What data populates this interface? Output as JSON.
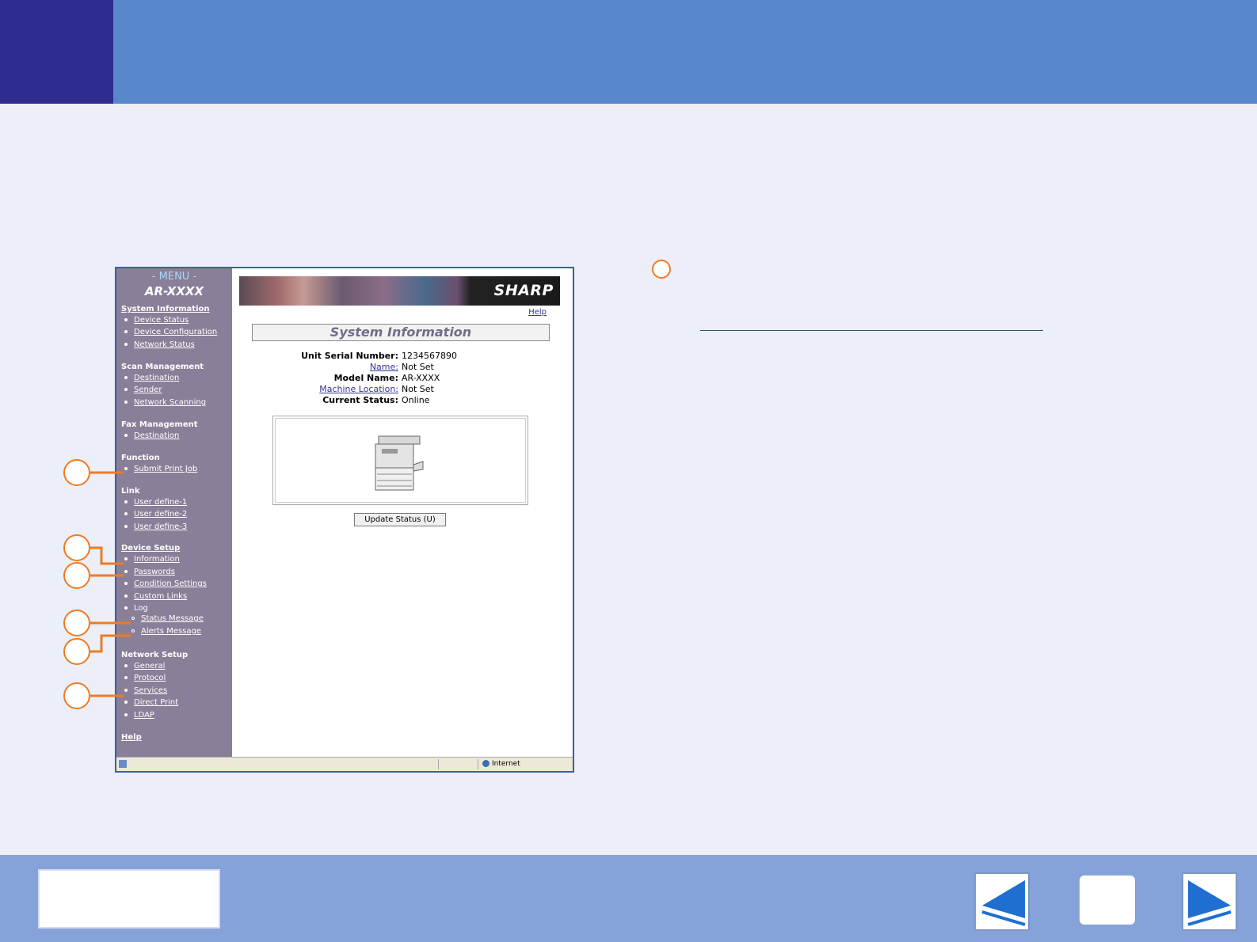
{
  "sidebar": {
    "menu_title": "- MENU -",
    "model": "AR-XXXX",
    "sections": {
      "system_information": {
        "title": "System Information",
        "items": [
          "Device Status",
          "Device Configuration",
          "Network Status"
        ]
      },
      "scan_management": {
        "title": "Scan Management",
        "items": [
          "Destination",
          "Sender",
          "Network Scanning"
        ]
      },
      "fax_management": {
        "title": "Fax Management",
        "items": [
          "Destination"
        ]
      },
      "function": {
        "title": "Function",
        "items": [
          "Submit Print Job"
        ]
      },
      "link": {
        "title": "Link",
        "items": [
          "User define-1",
          "User define-2",
          "User define-3"
        ]
      },
      "device_setup": {
        "title": "Device Setup",
        "items": [
          "Information",
          "Passwords",
          "Condition Settings",
          "Custom Links",
          "Log"
        ],
        "sub_items": [
          "Status Message",
          "Alerts Message"
        ]
      },
      "network_setup": {
        "title": "Network Setup",
        "items": [
          "General",
          "Protocol",
          "Services",
          "Direct Print",
          "LDAP"
        ]
      },
      "help": {
        "title": "Help"
      }
    }
  },
  "main": {
    "brand": "SHARP",
    "help_link": "Help",
    "title": "System Information",
    "fields": [
      {
        "label": "Unit Serial Number:",
        "value": "1234567890"
      },
      {
        "label": "Name:",
        "value": "Not Set"
      },
      {
        "label": "Model Name:",
        "value": "AR-XXXX"
      },
      {
        "label": "Machine Location:",
        "value": "Not Set"
      },
      {
        "label": "Current Status:",
        "value": "Online"
      }
    ],
    "update_button": "Update Status (U)"
  },
  "statusbar": {
    "zone": "Internet"
  },
  "colors": {
    "header": "#5987cc",
    "header_corner": "#2e2d8f",
    "footer": "#86a3d9",
    "callout": "#ee7b22",
    "sidebar": "#8a7f98"
  }
}
